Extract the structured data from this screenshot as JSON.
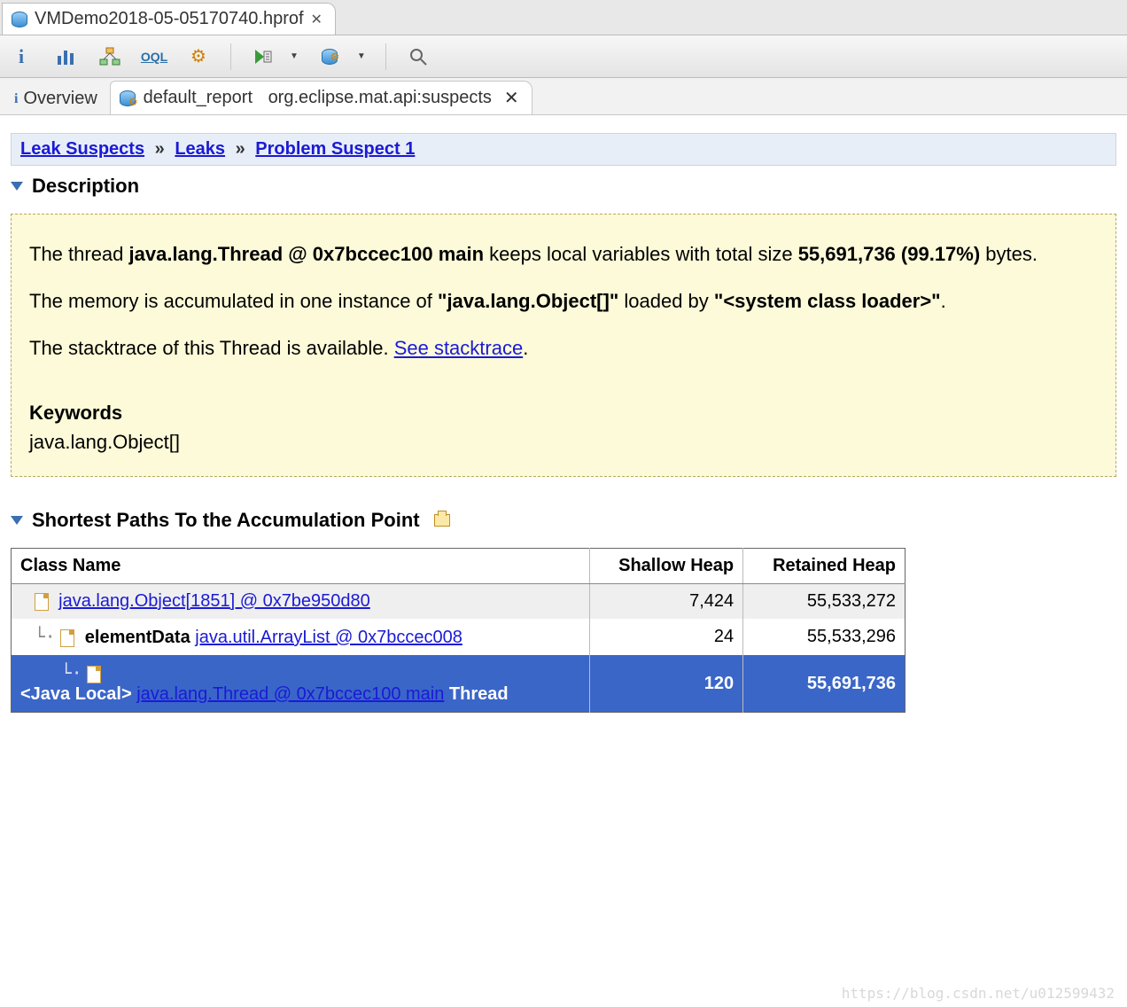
{
  "file_tab": {
    "name": "VMDemo2018-05-05170740.hprof"
  },
  "toolbar": {
    "icons": [
      "info",
      "histogram",
      "tree",
      "oql",
      "gear",
      "run",
      "db",
      "search"
    ]
  },
  "subtabs": {
    "overview": "Overview",
    "report_prefix": "default_report",
    "report_suffix": "org.eclipse.mat.api:suspects"
  },
  "breadcrumb": {
    "items": [
      "Leak Suspects",
      "Leaks",
      "Problem Suspect 1"
    ]
  },
  "sections": {
    "description": "Description",
    "shortest_paths": "Shortest Paths To the Accumulation Point"
  },
  "description": {
    "p1_pre": "The thread ",
    "p1_bold": "java.lang.Thread @ 0x7bccec100 main",
    "p1_mid": " keeps local variables with total size ",
    "p1_size": "55,691,736 (99.17%)",
    "p1_post": " bytes.",
    "p2_pre": "The memory is accumulated in one instance of ",
    "p2_bold1": "\"java.lang.Object[]\"",
    "p2_mid": " loaded by ",
    "p2_bold2": "\"<system class loader>\"",
    "p2_post": ".",
    "p3_pre": "The stacktrace of this Thread is available. ",
    "p3_link": "See stacktrace",
    "p3_post": ".",
    "keywords_head": "Keywords",
    "keywords_val": "java.lang.Object[]"
  },
  "paths": {
    "headers": {
      "class": "Class Name",
      "shallow": "Shallow Heap",
      "retained": "Retained Heap"
    },
    "rows": [
      {
        "indent": 0,
        "prefix": "",
        "link": "java.lang.Object[1851] @ 0x7be950d80",
        "suffix": "",
        "shallow": "7,424",
        "retained": "55,533,272"
      },
      {
        "indent": 1,
        "prefix": "elementData ",
        "link": "java.util.ArrayList @ 0x7bccec008",
        "suffix": "",
        "shallow": "24",
        "retained": "55,533,296"
      },
      {
        "indent": 2,
        "prefix": "<Java Local> ",
        "link": "java.lang.Thread @ 0x7bccec100 main",
        "suffix": " Thread",
        "shallow": "120",
        "retained": "55,691,736"
      }
    ]
  },
  "watermark": "https://blog.csdn.net/u012599432"
}
